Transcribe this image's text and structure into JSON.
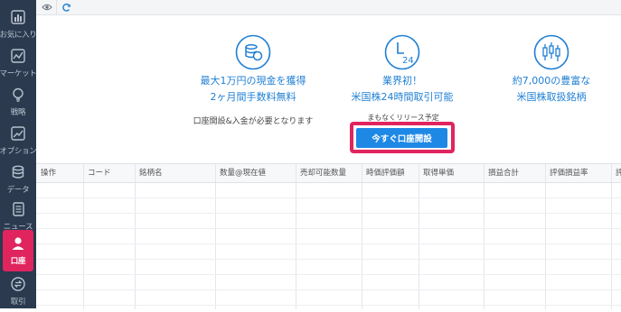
{
  "sidebar": {
    "items": [
      {
        "label": "お気に入り",
        "icon": "chart-grid-icon"
      },
      {
        "label": "マーケット",
        "icon": "line-chart-icon"
      },
      {
        "label": "戦略",
        "icon": "lightbulb-icon"
      },
      {
        "label": "オプション",
        "icon": "chart-box-icon"
      },
      {
        "label": "データ",
        "icon": "database-icon"
      },
      {
        "label": "ニュース",
        "icon": "document-icon"
      },
      {
        "label": "口座",
        "icon": "user-icon",
        "active": true
      },
      {
        "label": "取引",
        "icon": "exchange-icon"
      }
    ],
    "active_color": "#e0245e",
    "background": "#2b3a4f"
  },
  "toolbar": {
    "icons": [
      "eye-icon",
      "refresh-icon"
    ]
  },
  "promo": {
    "features": [
      {
        "icon": "coins-icon",
        "line1": "最大1万円の現金を獲得",
        "line2": "2ヶ月間手数料無料",
        "note": "口座開設&入金が必要となります"
      },
      {
        "icon": "clock-24-icon",
        "line1": "業界初！",
        "line2": "米国株24時間取引可能"
      },
      {
        "icon": "candlestick-icon",
        "line1": "約7,000の豊富な",
        "line2": "米国株取扱銘柄"
      }
    ],
    "clock_text": "24",
    "coming_soon": "まもなくリリース予定",
    "cta_label": "今すぐ口座開設",
    "accent_color": "#1f7fd3"
  },
  "table": {
    "columns": [
      "操作",
      "コード",
      "銘柄名",
      "数量@現在値",
      "売却可能数量",
      "時価評価額",
      "取得単価",
      "損益合計",
      "評価損益率",
      "評"
    ]
  }
}
